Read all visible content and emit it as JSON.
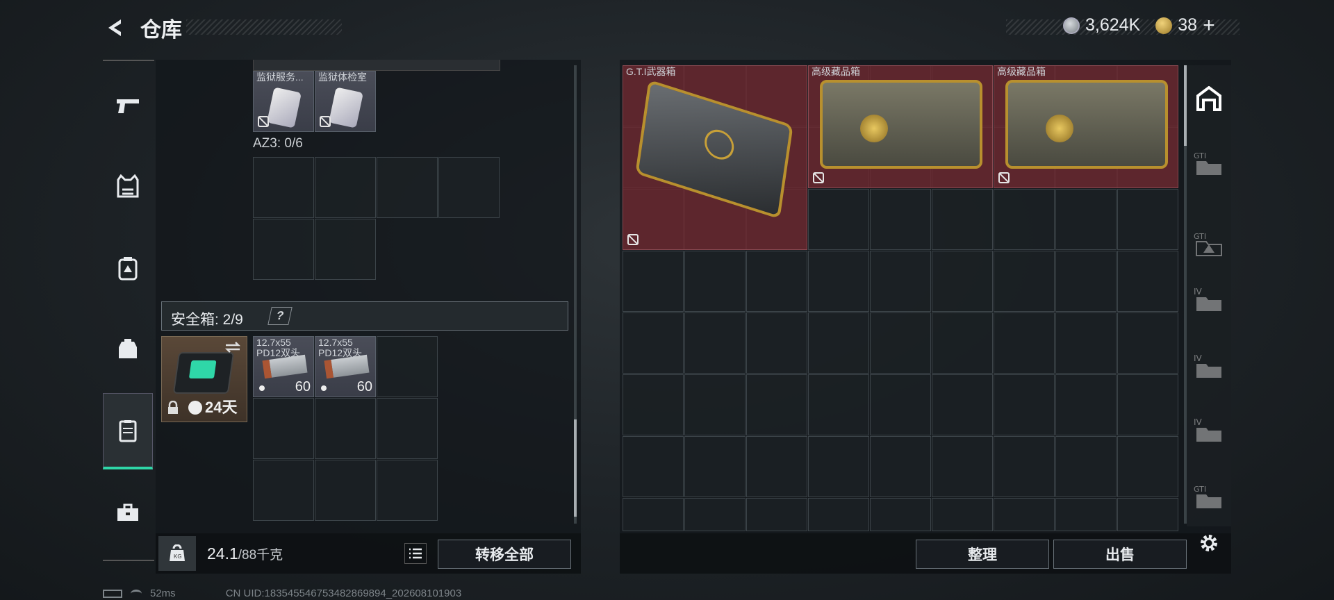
{
  "header": {
    "title": "仓库",
    "currency_amount": "3,624K",
    "gold_amount": "38",
    "gold_plus": "+"
  },
  "sidebar": {
    "items": [
      {
        "icon": "pistol-icon"
      },
      {
        "icon": "vest-icon"
      },
      {
        "icon": "armor-icon"
      },
      {
        "icon": "backpack-icon"
      },
      {
        "icon": "container-icon",
        "active": true
      },
      {
        "icon": "toolbox-icon"
      }
    ]
  },
  "left_panel": {
    "top_items": [
      {
        "name": "监狱服务..."
      },
      {
        "name": "监狱体检室"
      }
    ],
    "az3_label": "AZ3: 0/6",
    "safebox_label": "安全箱: 2/9",
    "safebox_help": "?",
    "safebox_days": "24天",
    "ammo": [
      {
        "name_line1": "12.7x55",
        "name_line2": "PD12双头",
        "count": "60"
      },
      {
        "name_line1": "12.7x55",
        "name_line2": "PD12双头",
        "count": "60"
      }
    ],
    "weight_value": "24.1",
    "weight_max": "/88千克",
    "transfer_all": "转移全部"
  },
  "right_panel": {
    "items": [
      {
        "name": "G.T.I武器箱"
      },
      {
        "name": "高级藏品箱"
      },
      {
        "name": "高级藏品箱"
      }
    ],
    "sort_button": "整理",
    "sell_button": "出售"
  },
  "right_sidebar": {
    "tabs": [
      "warehouse-icon",
      "gti-folder-icon",
      "gti-warning-folder-icon",
      "iv-folder-icon",
      "iv-folder-icon",
      "iv-folder-icon",
      "gti-hand-folder-icon"
    ]
  },
  "footer": {
    "ping": "52ms",
    "uid": "CN UID:1835455467534828698​94_202608101903"
  },
  "colors": {
    "accent": "#2fd7a8",
    "red_cell": "#6e2830",
    "gold": "#c8a038"
  }
}
